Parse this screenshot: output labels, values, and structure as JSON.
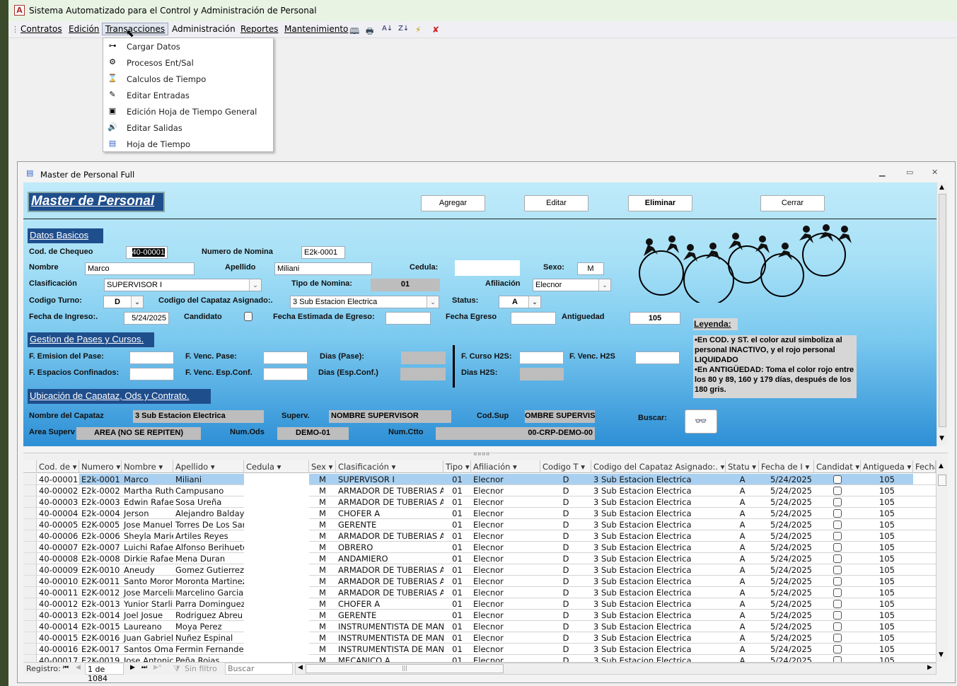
{
  "app": {
    "title": "Sistema Automatizado para el Control y Administración de Personal",
    "logo_letter": "A"
  },
  "menu": {
    "items": [
      "Contratos",
      "Edición",
      "Transacciones",
      "Administración",
      "Reportes",
      "Mantenimiento"
    ],
    "active": "Transacciones",
    "toolbar_icons": [
      "book-icon",
      "print-icon",
      "sort-ascending-icon",
      "sort-descending-icon",
      "filter-icon",
      "remove-filter-icon"
    ]
  },
  "dropdown": {
    "items": [
      {
        "icon": "key-icon",
        "label": "Cargar Datos"
      },
      {
        "icon": "process-icon",
        "label": "Procesos Ent/Sal"
      },
      {
        "icon": "hourglass-icon",
        "label": "Calculos de Tiempo"
      },
      {
        "icon": "pencil-icon",
        "label": "Editar Entradas"
      },
      {
        "icon": "edit-sheet-icon",
        "label": "Edición Hoja de Tiempo General"
      },
      {
        "icon": "speaker-icon",
        "label": "Editar Salidas"
      },
      {
        "icon": "form-icon",
        "label": "Hoja de Tiempo"
      }
    ]
  },
  "window": {
    "title": "Master de Personal Full"
  },
  "form": {
    "title": "Master de Personal",
    "buttons": {
      "add": "Agregar",
      "edit": "Editar",
      "delete": "Eliminar",
      "close": "Cerrar"
    },
    "sections": {
      "basic": "Datos Basicos",
      "passes": "Gestion de Pases y Cursos.",
      "location": "Ubicación de Capataz, Ods y Contrato."
    },
    "labels": {
      "cod": "Cod. de Chequeo",
      "nomina": "Numero de Nomina",
      "nombre": "Nombre",
      "apellido": "Apellido",
      "cedula": "Cedula:",
      "sexo": "Sexo:",
      "clasif": "Clasificación",
      "tipo_nomina": "Tipo de Nomina:",
      "afiliacion": "Afiliación",
      "turno": "Codigo Turno:",
      "capataz": "Codigo del Capataz Asignado:.",
      "status": "Status:",
      "fecha_ingreso": "Fecha de Ingreso:.",
      "candidato": "Candidato",
      "fecha_est": "Fecha Estimada de Egreso:",
      "fecha_egreso": "Fecha Egreso",
      "antiguedad": "Antiguedad",
      "emision_pase": "F. Emision del Pase:",
      "venc_pase": "F. Venc. Pase:",
      "dias_pase": "Dias (Pase):",
      "espacios": "F. Espacios Confinados:",
      "venc_esp": "F. Venc. Esp.Conf.",
      "dias_esp": "Dias (Esp.Conf.)",
      "curso_h2s": "F. Curso H2S:",
      "venc_h2s": "F. Venc. H2S",
      "dias_h2s": "Dias H2S:",
      "nombre_capataz": "Nombre del Capataz",
      "superv": "Superv.",
      "cod_sup": "Cod.Sup",
      "area": "Area Superv",
      "num_ods": "Num.Ods",
      "num_ctto": "Num.Ctto",
      "buscar": "Buscar:"
    },
    "values": {
      "cod": "40-00001",
      "nomina": "E2k-0001",
      "nombre": "Marco",
      "apellido": "Miliani",
      "cedula": "",
      "sexo": "M",
      "clasif": "SUPERVISOR I",
      "tipo_nomina": "01",
      "afiliacion": "Elecnor",
      "turno": "D",
      "capataz": "3 Sub Estacion Electrica",
      "status": "A",
      "fecha_ingreso": "5/24/2025",
      "candidato": false,
      "fecha_est": "",
      "fecha_egreso": "",
      "antiguedad": "105",
      "nombre_capataz": "3 Sub Estacion Electrica",
      "superv": "NOMBRE SUPERVISOR",
      "cod_sup": "OMBRE SUPERVISC",
      "area": "AREA (NO SE REPITEN)",
      "num_ods": "DEMO-01",
      "num_ctto": "00-CRP-DEMO-00"
    },
    "legend": {
      "title": "Leyenda:",
      "text1": "•En COD. y ST. el color azul simboliza al personal INACTIVO, y el rojo personal LIQUIDADO",
      "text2": "•En ANTIGÜEDAD: Toma el color rojo entre los 80 y 89, 160 y 179 días, después de los 180 gris."
    }
  },
  "grid": {
    "columns": [
      "Cod. de",
      "Numero",
      "Nombre",
      "Apellido",
      "Cedula",
      "Sex",
      "Clasificación",
      "Tipo",
      "Afiliación",
      "Codigo T",
      "Codigo del Capataz Asignado:.",
      "Statu",
      "Fecha de I",
      "Candidat",
      "Antigueda",
      "Fecha"
    ],
    "rows": [
      [
        "40-00001",
        "E2k-0001",
        "Marco",
        "Miliani",
        "",
        "M",
        "SUPERVISOR I",
        "01",
        "Elecnor",
        "D",
        "3 Sub Estacion Electrica",
        "A",
        "5/24/2025",
        false,
        "105"
      ],
      [
        "40-00002",
        "E2k-0002",
        "Martha Ruth",
        "Campusano",
        "",
        "M",
        "ARMADOR DE TUBERIAS A",
        "01",
        "Elecnor",
        "D",
        "3 Sub Estacion Electrica",
        "A",
        "5/24/2025",
        false,
        "105"
      ],
      [
        "40-00003",
        "E2k-0003",
        "Edwin Rafael",
        "Sosa Ureña",
        "",
        "M",
        "ARMADOR DE TUBERIAS A",
        "01",
        "Elecnor",
        "D",
        "3 Sub Estacion Electrica",
        "A",
        "5/24/2025",
        false,
        "105"
      ],
      [
        "40-00004",
        "E2k-0004",
        "Jerson",
        "Alejandro Baldaya",
        "",
        "M",
        "CHOFER A",
        "01",
        "Elecnor",
        "D",
        "3 Sub Estacion Electrica",
        "A",
        "5/24/2025",
        false,
        "105"
      ],
      [
        "40-00005",
        "E2K-0005",
        "Jose Manuel",
        "Torres De Los Sar",
        "",
        "M",
        "GERENTE",
        "01",
        "Elecnor",
        "D",
        "3 Sub Estacion Electrica",
        "A",
        "5/24/2025",
        false,
        "105"
      ],
      [
        "40-00006",
        "E2k-0006",
        "Sheyla Marie",
        "Artiles Reyes",
        "",
        "M",
        "ARMADOR DE TUBERIAS A",
        "01",
        "Elecnor",
        "D",
        "3 Sub Estacion Electrica",
        "A",
        "5/24/2025",
        false,
        "105"
      ],
      [
        "40-00007",
        "E2k-0007",
        "Luichi Rafael",
        "Alfonso Berihuete",
        "",
        "M",
        "OBRERO",
        "01",
        "Elecnor",
        "D",
        "3 Sub Estacion Electrica",
        "A",
        "5/24/2025",
        false,
        "105"
      ],
      [
        "40-00008",
        "E2k-0008",
        "Dirkie Rafael",
        "Mena Duran",
        "",
        "M",
        "ANDAMIERO",
        "01",
        "Elecnor",
        "D",
        "3 Sub Estacion Electrica",
        "A",
        "5/24/2025",
        false,
        "105"
      ],
      [
        "40-00009",
        "E2K-0010",
        "Aneudy",
        "Gomez Gutierrez",
        "",
        "M",
        "ARMADOR DE TUBERIAS A",
        "01",
        "Elecnor",
        "D",
        "3 Sub Estacion Electrica",
        "A",
        "5/24/2025",
        false,
        "105"
      ],
      [
        "40-00010",
        "E2K-0011",
        "Santo Moror",
        "Moronta Martinez",
        "",
        "M",
        "ARMADOR DE TUBERIAS A",
        "01",
        "Elecnor",
        "D",
        "3 Sub Estacion Electrica",
        "A",
        "5/24/2025",
        false,
        "105"
      ],
      [
        "40-00011",
        "E2K-0012",
        "Jose Marcelir",
        "Marcelino Garcia",
        "",
        "M",
        "ARMADOR DE TUBERIAS A",
        "01",
        "Elecnor",
        "D",
        "3 Sub Estacion Electrica",
        "A",
        "5/24/2025",
        false,
        "105"
      ],
      [
        "40-00012",
        "E2k-0013",
        "Yunior Starlir",
        "Parra Dominguez",
        "",
        "M",
        "CHOFER A",
        "01",
        "Elecnor",
        "D",
        "3 Sub Estacion Electrica",
        "A",
        "5/24/2025",
        false,
        "105"
      ],
      [
        "40-00013",
        "E2k-0014",
        "Joel Josue",
        "Rodriguez Abreu",
        "",
        "M",
        "GERENTE",
        "01",
        "Elecnor",
        "D",
        "3 Sub Estacion Electrica",
        "A",
        "5/24/2025",
        false,
        "105"
      ],
      [
        "40-00014",
        "E2k-0015",
        "Laureano",
        "Moya Perez",
        "",
        "M",
        "INSTRUMENTISTA DE MAN",
        "01",
        "Elecnor",
        "D",
        "3 Sub Estacion Electrica",
        "A",
        "5/24/2025",
        false,
        "105"
      ],
      [
        "40-00015",
        "E2K-0016",
        "Juan Gabriel",
        "Nuñez Espinal",
        "",
        "M",
        "INSTRUMENTISTA DE MAN",
        "01",
        "Elecnor",
        "D",
        "3 Sub Estacion Electrica",
        "A",
        "5/24/2025",
        false,
        "105"
      ],
      [
        "40-00016",
        "E2K-0017",
        "Santos Omai",
        "Fermin Fernandez",
        "",
        "M",
        "INSTRUMENTISTA DE MAN",
        "01",
        "Elecnor",
        "D",
        "3 Sub Estacion Electrica",
        "A",
        "5/24/2025",
        false,
        "105"
      ],
      [
        "40-00017",
        "E2K-0019",
        "Jose Antonic",
        "Peña Rojas",
        "",
        "M",
        "MECANICO A",
        "01",
        "Elecnor",
        "D",
        "3 Sub Estacion Electrica",
        "A",
        "5/24/2025",
        false,
        "105"
      ]
    ],
    "selected_row": 0
  },
  "navigation": {
    "record_label": "Registro:",
    "position": "1 de 1084",
    "filter": "Sin filtro",
    "search_placeholder": "Buscar"
  },
  "colors": {
    "section_bg": "#1f4e8c",
    "selected_row": "#a9d0f0",
    "form_gradient_top": "#bfeafa",
    "form_gradient_bottom": "#2d8fd6"
  }
}
